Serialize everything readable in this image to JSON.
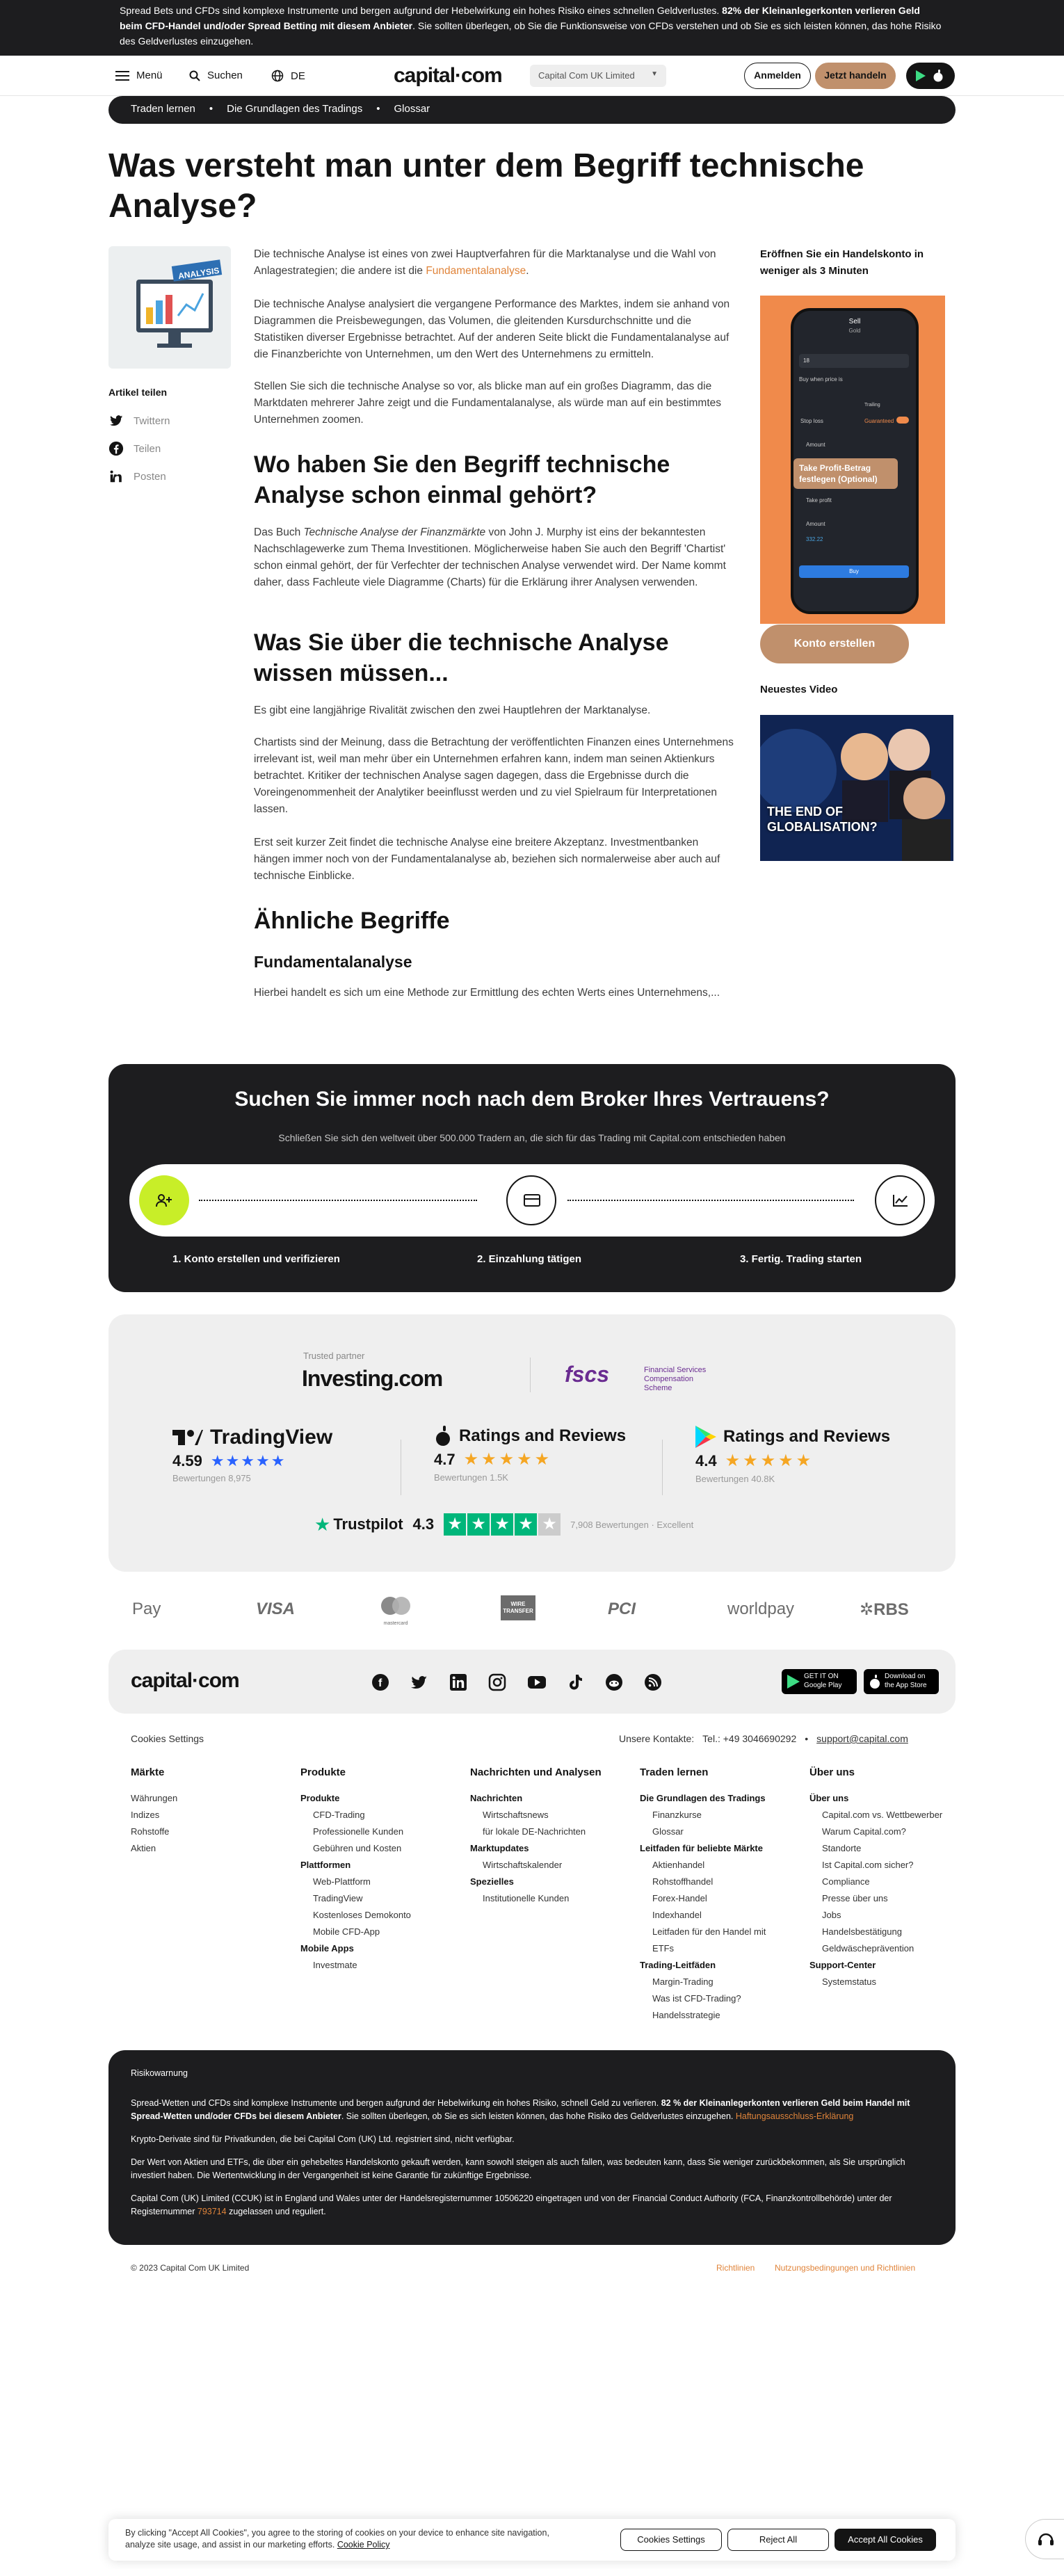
{
  "risk_banner": {
    "text1": "Spread Bets und CFDs sind komplexe Instrumente und bergen aufgrund der Hebelwirkung ein hohes Risiko eines schnellen Geldverlustes.",
    "bold": "82% der Kleinanlegerkonten verlieren Geld beim CFD-Handel und/oder Spread Betting mit diesem Anbieter",
    "text2": ". Sie sollten überlegen, ob Sie die Funktionsweise von CFDs verstehen und ob Sie es sich leisten können, das hohe Risiko des Geldverlustes einzugehen."
  },
  "header": {
    "menu": "Menü",
    "search": "Suchen",
    "lang": "DE",
    "logo": "capital·com",
    "entity": "Capital Com UK Limited",
    "login": "Anmelden",
    "trade": "Jetzt handeln"
  },
  "breadcrumb": [
    "Traden lernen",
    "Die Grundlagen des Tradings",
    "Glossar"
  ],
  "page_title": "Was versteht man unter dem Begriff technische Analyse?",
  "share": {
    "title": "Artikel teilen",
    "twitter": "Twittern",
    "facebook": "Teilen",
    "linkedin": "Posten"
  },
  "thumb_label": "ANALYSIS",
  "article": {
    "p1a": "Die technische Analyse ist eines von zwei Hauptverfahren für die Marktanalyse und die Wahl von Anlagestrategien; die andere ist die ",
    "p1link": "Fundamentalanalyse",
    "p1b": ".",
    "p2": "Die technische Analyse analysiert die vergangene Performance des Marktes, indem sie anhand von Diagrammen die Preisbewegungen, das Volumen, die gleitenden Kursdurchschnitte und die Statistiken diverser Ergebnisse betrachtet. Auf der anderen Seite blickt die Fundamentalanalyse auf die Finanzberichte von Unternehmen, um den Wert des Unternehmens zu ermitteln.",
    "p3": "Stellen Sie sich die technische Analyse so vor, als blicke man auf ein großes Diagramm, das die Marktdaten mehrerer Jahre zeigt und die Fundamentalanalyse, als würde man auf ein bestimmtes Unternehmen zoomen.",
    "h2a": "Wo haben Sie den Begriff technische Analyse schon einmal gehört?",
    "p4a": "Das Buch ",
    "p4i": "Technische Analyse der Finanzmärkte",
    "p4b": " von John J. Murphy ist eins der bekanntesten Nachschlagewerke zum Thema Investitionen. Möglicherweise haben Sie auch den Begriff 'Chartist' schon einmal gehört, der für Verfechter der technischen Analyse verwendet wird. Der Name kommt daher, dass Fachleute viele Diagramme (Charts) für die Erklärung ihrer Analysen verwenden.",
    "h2b": "Was Sie über die technische Analyse wissen müssen...",
    "p5": "Es gibt eine langjährige Rivalität zwischen den zwei Hauptlehren der Marktanalyse.",
    "p6": "Chartists sind der Meinung, dass die Betrachtung der veröffentlichten Finanzen eines Unternehmens irrelevant ist, weil man mehr über ein Unternehmen erfahren kann, indem man seinen Aktienkurs betrachtet. Kritiker der technischen Analyse sagen dagegen, dass die Ergebnisse durch die Voreingenommenheit der Analytiker beeinflusst werden und zu viel Spielraum für Interpretationen lassen.",
    "p7": "Erst seit kurzer Zeit findet die technische Analyse eine breitere Akzeptanz. Investmentbanken hängen immer noch von der Fundamentalanalyse ab, beziehen sich normalerweise aber auch auf technische Einblicke.",
    "h2c": "Ähnliche Begriffe",
    "h3": "Fundamentalanalyse",
    "p8": "Hierbei handelt es sich um eine Methode zur Ermittlung des echten Werts eines Unternehmens,..."
  },
  "sidebar": {
    "promo_title": "Eröffnen Sie ein Handelskonto in weniger als 3 Minuten",
    "phone_title": "Sell",
    "phone_sub": "Gold",
    "phone_rows": [
      "Buy when price is",
      "Stop loss",
      "Amount",
      "Take profit",
      "Amount",
      "Buy"
    ],
    "phone_values": [
      "18",
      "Guaranteed",
      "332.22"
    ],
    "phone_toggle_label": "Trailing",
    "phone_callout": "Take Profit-Betrag festlegen (Optional)",
    "open_account": "Konto erstellen",
    "video_title": "Neuestes Video",
    "video_caption": "THE END OF GLOBALISATION?"
  },
  "cta": {
    "title": "Suchen Sie immer noch nach dem Broker Ihres Vertrauens?",
    "subtitle": "Schließen Sie sich den weltweit über 500.000 Tradern an, die sich für das Trading mit Capital.com entschieden haben",
    "steps": [
      "1. Konto erstellen und verifizieren",
      "2. Einzahlung tätigen",
      "3. Fertig. Trading starten"
    ]
  },
  "trust": {
    "partner_label": "Trusted partner",
    "partner_name": "Investing.com",
    "fscs": "fscs",
    "fscs_sub": "Financial Services Compensation Scheme",
    "ratings": [
      {
        "name": "TradingView",
        "score": "4.59",
        "count": "Bewertungen 8,975"
      },
      {
        "name": "Ratings and Reviews",
        "score": "4.7",
        "count": "Bewertungen 1.5K"
      },
      {
        "name": "Ratings and Reviews",
        "score": "4.4",
        "count": "Bewertungen 40.8K"
      }
    ],
    "trustpilot": "Trustpilot",
    "tp_score": "4.3",
    "tp_count": "7,908 Bewertungen · Excellent"
  },
  "payments": [
    "Pay",
    "VISA",
    "mastercard",
    "WIRE TRANSFER",
    "PCI",
    "worldpay",
    "RBS"
  ],
  "footer": {
    "logo": "capital·com",
    "google": "GET IT ON Google Play",
    "apple": "Download on the App Store",
    "cookies": "Cookies Settings",
    "contacts_label": "Unsere Kontakte:",
    "phone": "Tel.: +49 3046690292",
    "email": "support@capital.com",
    "cols": [
      {
        "title": "Märkte",
        "items": [
          "Währungen",
          "Indizes",
          "Rohstoffe",
          "Aktien"
        ]
      },
      {
        "title": "Produkte",
        "groups": [
          {
            "h": "Produkte",
            "items": [
              "CFD-Trading",
              "Professionelle Kunden",
              "Gebühren und Kosten"
            ]
          },
          {
            "h": "Plattformen",
            "items": [
              "Web-Plattform",
              "TradingView",
              "Kostenloses Demokonto",
              "Mobile CFD-App"
            ]
          },
          {
            "h": "Mobile Apps",
            "items": [
              "Investmate"
            ]
          }
        ]
      },
      {
        "title": "Nachrichten und Analysen",
        "groups": [
          {
            "h": "Nachrichten",
            "items": [
              "Wirtschaftsnews",
              "für lokale DE-Nachrichten"
            ]
          },
          {
            "h": "Marktupdates",
            "items": [
              "Wirtschaftskalender"
            ]
          },
          {
            "h": "Spezielles",
            "items": [
              "Institutionelle Kunden"
            ]
          }
        ]
      },
      {
        "title": "Traden lernen",
        "groups": [
          {
            "h": "Die Grundlagen des Tradings",
            "items": [
              "Finanzkurse",
              "Glossar"
            ]
          },
          {
            "h": "Leitfaden für beliebte Märkte",
            "items": [
              "Aktienhandel",
              "Rohstoffhandel",
              "Forex-Handel",
              "Indexhandel",
              "Leitfaden für den Handel mit ETFs"
            ]
          },
          {
            "h": "Trading-Leitfäden",
            "items": [
              "Margin-Trading",
              "Was ist CFD-Trading?",
              "Handelsstrategie"
            ]
          }
        ]
      },
      {
        "title": "Über uns",
        "groups": [
          {
            "h": "Über uns",
            "items": [
              "Capital.com vs. Wettbewerber",
              "Warum Capital.com?",
              "Standorte",
              "Ist Capital.com sicher?",
              "Compliance",
              "Presse über uns",
              "Jobs",
              "Handelsbestätigung",
              "Geldwäscheprävention"
            ]
          },
          {
            "h": "Support-Center",
            "items": [
              "Systemstatus"
            ]
          }
        ]
      }
    ]
  },
  "risk": {
    "title": "Risikowarnung",
    "p1a": "Spread-Wetten und CFDs sind komplexe Instrumente und bergen aufgrund der Hebelwirkung ein hohes Risiko, schnell Geld zu verlieren. ",
    "p1b": "82 % der Kleinanlegerkonten verlieren Geld beim Handel mit Spread-Wetten und/oder CFDs bei diesem Anbieter",
    "p1c": ". Sie sollten überlegen, ob Sie es sich leisten können, das hohe Risiko des Geldverlustes einzugehen. ",
    "p1link": "Haftungsausschluss-Erklärung",
    "p2": "Krypto-Derivate sind für Privatkunden, die bei Capital Com (UK) Ltd. registriert sind, nicht verfügbar.",
    "p3": "Der Wert von Aktien und ETFs, die über ein gehebeltes Handelskonto gekauft werden, kann sowohl steigen als auch fallen, was bedeuten kann, dass Sie weniger zurückbekommen, als Sie ursprünglich investiert haben. Die Wertentwicklung in der Vergangenheit ist keine Garantie für zukünftige Ergebnisse.",
    "p4a": "Capital Com (UK) Limited (CCUK) ist in England und Wales unter der Handelsregisternummer 10506220 eingetragen und von der Financial Conduct Authority (FCA, Finanzkontrollbehörde) unter der Registernummer ",
    "p4link": "793714",
    "p4b": " zugelassen und reguliert."
  },
  "bottom": {
    "copyright": "© 2023 Capital Com UK Limited",
    "links": [
      "Richtlinien",
      "Nutzungsbedingungen und Richtlinien"
    ]
  },
  "cookie": {
    "text": "By clicking \"Accept All Cookies\", you agree to the storing of cookies on your device to enhance site navigation, analyze site usage, and assist in our marketing efforts.",
    "policy": "Cookie Policy",
    "settings": "Cookies Settings",
    "reject": "Reject All",
    "accept": "Accept All Cookies"
  }
}
